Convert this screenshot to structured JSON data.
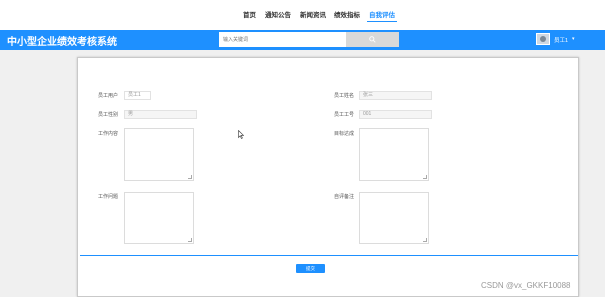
{
  "nav": {
    "items": [
      {
        "label": "首页"
      },
      {
        "label": "通知公告"
      },
      {
        "label": "新闻资讯"
      },
      {
        "label": "绩效指标"
      },
      {
        "label": "自我评估",
        "active": true
      }
    ],
    "accent_color": "#1e90ff"
  },
  "header": {
    "site_title": "中小型企业绩效考核系统",
    "search_placeholder": "输入关键词",
    "search_icon": "search-icon",
    "user_name": "员工1"
  },
  "form": {
    "employee_user_label": "员工用户",
    "employee_user_value": "员工1",
    "employee_name_label": "员工姓名",
    "employee_name_value": "张三",
    "employee_gender_label": "员工性别",
    "employee_gender_value": "男",
    "employee_id_label": "员工工号",
    "employee_id_value": "001",
    "work_content_label": "工作内容",
    "goal_achievement_label": "目标达成",
    "work_issues_label": "工作问题",
    "self_evaluation_remark_label": "自评备注",
    "submit_label": "提交"
  },
  "watermark": "CSDN @vx_GKKF10088"
}
